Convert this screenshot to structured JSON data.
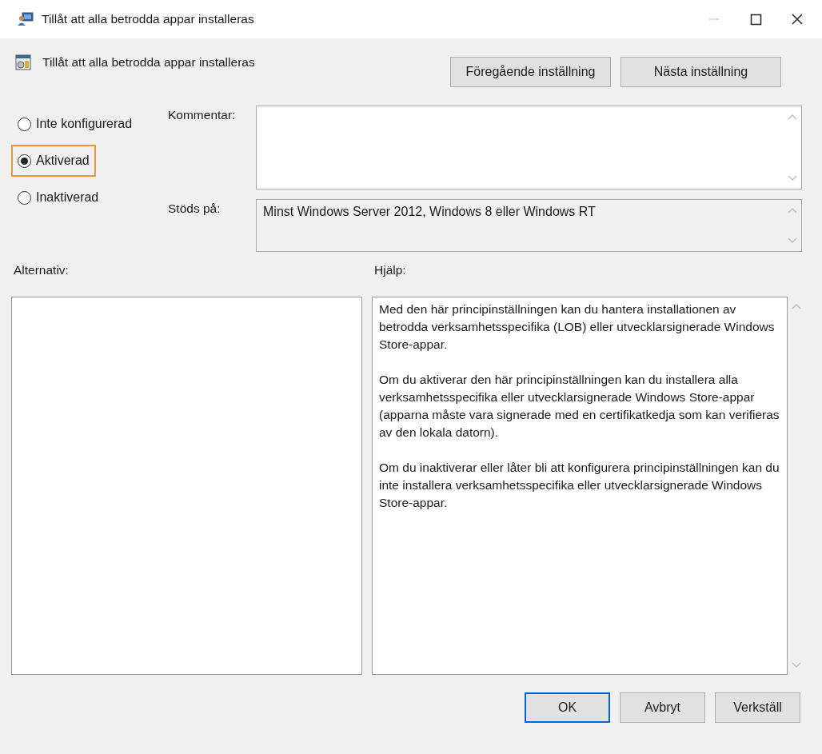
{
  "window": {
    "title": "Tillåt att alla betrodda appar installeras"
  },
  "policy": {
    "name": "Tillåt att alla betrodda appar installeras"
  },
  "nav_buttons": [
    "Föregående inställning",
    "Nästa inställning"
  ],
  "options": [
    {
      "label": "Inte konfigurerad",
      "selected": false,
      "highlighted": false
    },
    {
      "label": "Aktiverad",
      "selected": true,
      "highlighted": true
    },
    {
      "label": "Inaktiverad",
      "selected": false,
      "highlighted": false
    }
  ],
  "comment": {
    "label": "Kommentar:"
  },
  "supported": {
    "label": "Stöds på:",
    "value": "Minst Windows Server 2012, Windows 8 eller Windows RT"
  },
  "options_panel": {
    "label": "Alternativ:"
  },
  "help": {
    "label": "Hjälp:",
    "paragraphs": [
      "Med den här principinställningen kan du hantera installationen av betrodda verksamhetsspecifika (LOB) eller utvecklarsignerade Windows Store-appar.",
      "Om du aktiverar den här principinställningen kan du installera alla verksamhetsspecifika eller utvecklarsignerade Windows Store-appar (apparna måste vara signerade med en certifikatkedja som kan verifieras av den lokala datorn).",
      "Om du inaktiverar eller låter bli att konfigurera principinställningen kan du inte installera verksamhetsspecifika eller utvecklarsignerade Windows Store-appar."
    ]
  },
  "buttons": [
    {
      "label": "OK",
      "default": true
    },
    {
      "label": "Avbryt",
      "default": false
    },
    {
      "label": "Verkställ",
      "default": false
    }
  ]
}
